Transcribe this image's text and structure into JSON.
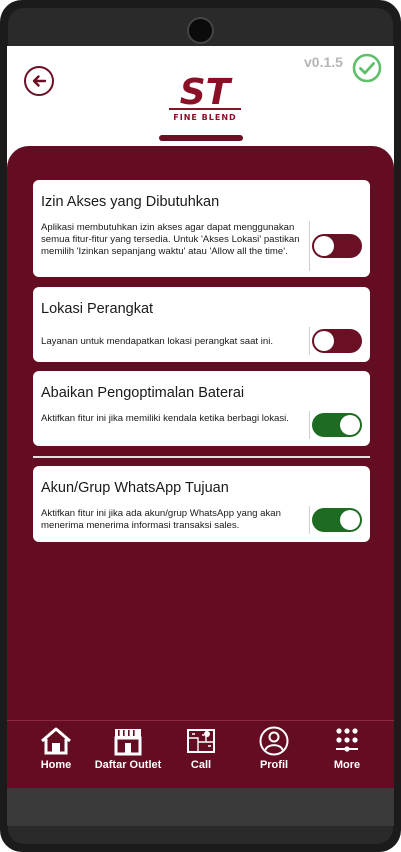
{
  "app": {
    "version": "v0.1.5",
    "logo_text": "ST",
    "logo_subtext": "FINE BLEND",
    "accent_color": "#640d22",
    "toggle_on_color": "#1e6b22",
    "check_color": "#5fbf6a"
  },
  "header": {
    "back_icon": "arrow-left-circle-icon",
    "status_icon": "check-circle-icon"
  },
  "permissions": [
    {
      "title": "Izin Akses yang Dibutuhkan",
      "description": "Aplikasi membutuhkan izin akses agar dapat menggunakan semua fitur-fitur yang tersedia. Untuk 'Akses Lokasi' pastikan memilih 'Izinkan sepanjang waktu' atau 'Allow all the time'.",
      "enabled": false
    },
    {
      "title": "Lokasi Perangkat",
      "description": "Layanan untuk mendapatkan lokasi perangkat saat ini.",
      "enabled": false
    },
    {
      "title": "Abaikan Pengoptimalan Baterai",
      "description": "Aktifkan fitur ini jika memiliki kendala ketika berbagi lokasi.",
      "enabled": true
    },
    {
      "title": "Akun/Grup WhatsApp Tujuan",
      "description": "Aktifkan fitur ini jika ada akun/grup WhatsApp yang akan menerima menerima informasi transaksi sales.",
      "enabled": true
    }
  ],
  "bottom_nav": [
    {
      "label": "Home",
      "icon": "home-icon"
    },
    {
      "label": "Daftar Outlet",
      "icon": "store-icon"
    },
    {
      "label": "Call",
      "icon": "map-icon"
    },
    {
      "label": "Profil",
      "icon": "profile-icon"
    },
    {
      "label": "More",
      "icon": "grid-more-icon"
    }
  ]
}
